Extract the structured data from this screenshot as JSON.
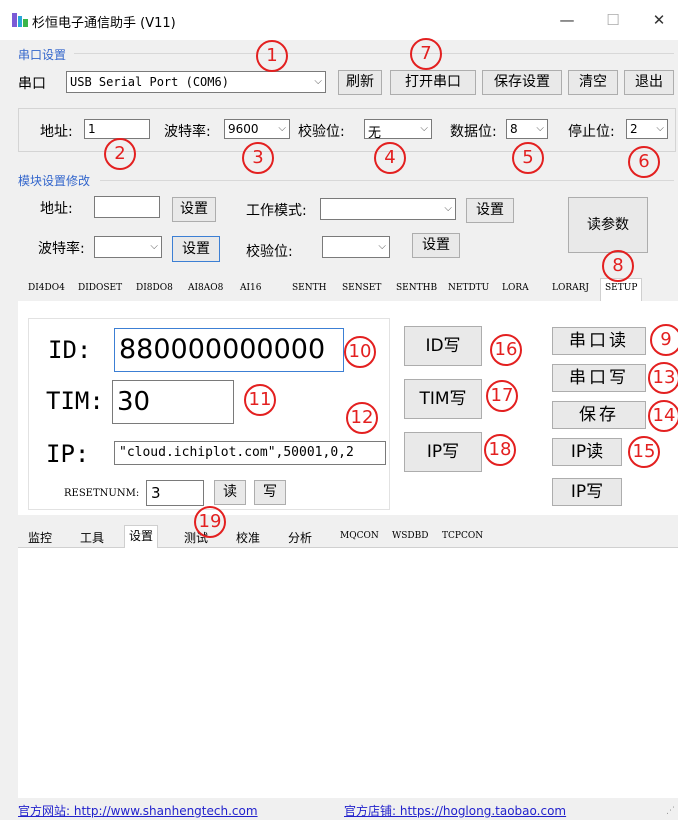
{
  "window": {
    "title": "杉恒电子通信助手 (V11)",
    "minimize": "—",
    "maximize": "☐",
    "close": "✕"
  },
  "serial_group": {
    "label": "串口设置",
    "port_label": "串口",
    "port_value": "USB Serial Port (COM6)",
    "refresh": "刷新",
    "open_port": "打开串口",
    "save_settings": "保存设置",
    "clear": "清空",
    "exit": "退出",
    "address_label": "地址:",
    "address_value": "1",
    "baud_label": "波特率:",
    "baud_value": "9600",
    "parity_label": "校验位:",
    "parity_value": "无",
    "databits_label": "数据位:",
    "databits_value": "8",
    "stopbits_label": "停止位:",
    "stopbits_value": "2"
  },
  "module_group": {
    "label": "模块设置修改",
    "address_label": "地址:",
    "address_value": "",
    "set1": "设置",
    "workmode_label": "工作模式:",
    "workmode_value": "",
    "set2": "设置",
    "baud_label": "波特率:",
    "baud_value": "",
    "set3": "设置",
    "parity_label": "校验位:",
    "parity_value": "",
    "set4": "设置",
    "read_params": "读参数"
  },
  "device_tabs": [
    "DI4DO4",
    "DIDOSET",
    "DI8DO8",
    "AI8AO8",
    "AI16",
    "SENTH",
    "SENSET",
    "SENTHB",
    "NETDTU",
    "LORA",
    "LORARJ",
    "SETUP"
  ],
  "setup": {
    "id_label": "ID:",
    "id_value": "880000000000",
    "tim_label": "TIM:",
    "tim_value": "30",
    "ip_label": "IP:",
    "ip_value": "\"cloud.ichiplot.com\",50001,0,2",
    "resetnum_label": "RESETNUNM:",
    "resetnum_value": "3",
    "read": "读",
    "write": "写",
    "id_write": "ID写",
    "tim_write": "TIM写",
    "ip_write": "IP写",
    "serial_read": "串口读",
    "serial_write": "串口写",
    "save": "保存",
    "ip_read": "IP读",
    "ip_write2": "IP写"
  },
  "bottom_tabs": [
    "监控",
    "工具",
    "设置",
    "测试",
    "校准",
    "分析",
    "MQCON",
    "WSDBD",
    "TCPCON"
  ],
  "footer": {
    "website": "官方网站: http://www.shanhengtech.com",
    "shop": "官方店铺: https://hoglong.taobao.com"
  },
  "callouts": [
    "1",
    "2",
    "3",
    "4",
    "5",
    "6",
    "7",
    "8",
    "9",
    "10",
    "11",
    "12",
    "13",
    "14",
    "15",
    "16",
    "17",
    "18",
    "19"
  ],
  "colors": {
    "callout": "#e32020",
    "group_label": "#3366cc",
    "link": "#2222cc"
  }
}
